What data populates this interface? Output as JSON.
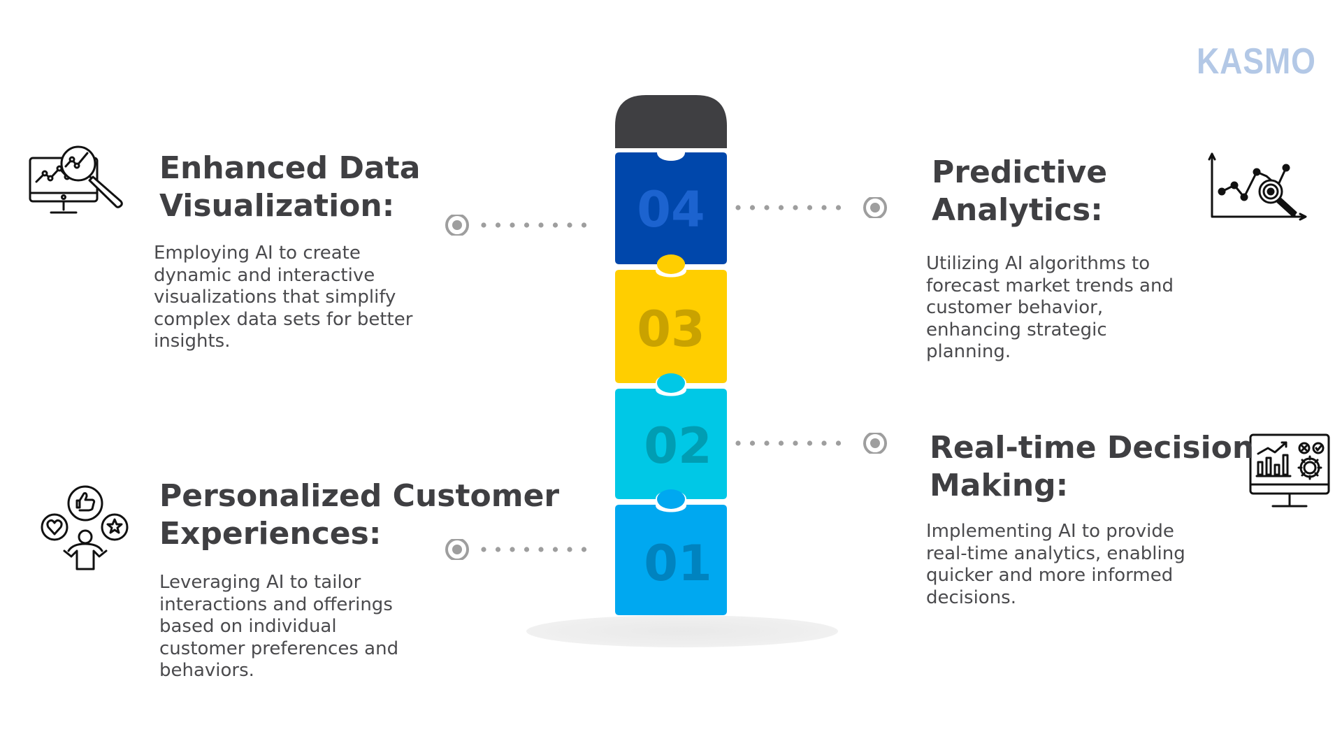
{
  "brand": {
    "logo_text": "KASMO",
    "logo_color": "#b3c8e6"
  },
  "puzzle": {
    "cap_color": "#3f3f42",
    "pieces": [
      {
        "number": "04",
        "color": "#0047ab",
        "number_color": "#1c63cf"
      },
      {
        "number": "03",
        "color": "#ffce00",
        "number_color": "#c9a200"
      },
      {
        "number": "02",
        "color": "#00c8e6",
        "number_color": "#009db3"
      },
      {
        "number": "01",
        "color": "#00a8f0",
        "number_color": "#0083bf"
      }
    ]
  },
  "connector_color": "#9e9e9e",
  "items": [
    {
      "key": "enhanced-data-visualization",
      "heading_line1": "Enhanced Data",
      "heading_line2": "Visualization:",
      "description_lines": [
        "Employing AI to create",
        "dynamic and interactive",
        "visualizations that simplify",
        "complex data sets for better",
        "insights."
      ],
      "icon": "monitor-chart-magnifier-icon",
      "step": "04"
    },
    {
      "key": "predictive-analytics",
      "heading_line1": "Predictive",
      "heading_line2": "Analytics:",
      "description_lines": [
        "Utilizing AI algorithms to",
        "forecast market trends and",
        "customer behavior,",
        "enhancing strategic",
        "planning."
      ],
      "icon": "line-chart-target-icon",
      "step": "04"
    },
    {
      "key": "real-time-decision-making",
      "heading_line1": "Real-time Decision",
      "heading_line2": "Making:",
      "description_lines": [
        "Implementing AI to provide",
        "real-time analytics, enabling",
        "quicker and more informed",
        "decisions."
      ],
      "icon": "monitor-dashboard-gear-icon",
      "step": "02"
    },
    {
      "key": "personalized-customer-experiences",
      "heading_line1": "Personalized Customer",
      "heading_line2": "Experiences:",
      "description_lines": [
        "Leveraging AI to tailor",
        "interactions and offerings",
        "based on individual",
        "customer preferences and",
        "behaviors."
      ],
      "icon": "person-preferences-icon",
      "step": "01"
    }
  ]
}
